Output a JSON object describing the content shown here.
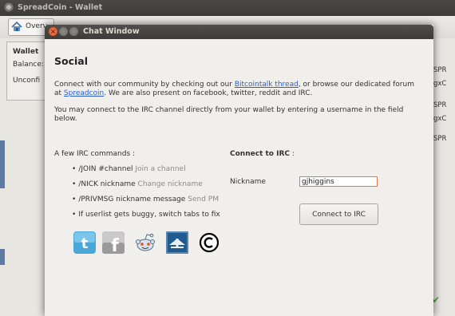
{
  "app": {
    "title": "SpreadCoin - Wallet",
    "toolbar": {
      "overview_label": "Overv"
    },
    "wallet_panel": {
      "heading": "Wallet",
      "balance_label": "Balance:",
      "unconfirmed_label": "Unconfi"
    },
    "right_fragments": [
      "SPR",
      "gxC",
      "SPR",
      "gxC",
      "SPR"
    ]
  },
  "dialog": {
    "title": "Chat Window",
    "heading": "Social",
    "intro": {
      "part1": "Connect with our community by checking out our ",
      "link1": "Bitcointalk thread",
      "part2": ", or browse our dedicated forum at ",
      "link2": "Spreadcoin",
      "part3": ". We are also present on facebook, twitter, reddit and IRC."
    },
    "irc_intro": "You may connect to the IRC channel directly from your wallet by entering a username in the field below.",
    "commands_title": "A few IRC commands :",
    "commands": [
      {
        "cmd": "/JOIN #channel",
        "hint": "Join a channel"
      },
      {
        "cmd": "/NICK nickname",
        "hint": "Change nickname"
      },
      {
        "cmd": "/PRIVMSG nickname message",
        "hint": "Send PM"
      },
      {
        "cmd": "If userlist gets buggy, switch tabs to fix",
        "hint": ""
      }
    ],
    "connect": {
      "title": "Connect to IRC",
      "title_suffix": " :",
      "nickname_label": "Nickname",
      "nickname_value": "gjhiggins",
      "button_label": "Connect to IRC"
    },
    "social_icons": [
      "twitter-icon",
      "facebook-icon",
      "reddit-icon",
      "bitcointalk-icon",
      "copyright-icon"
    ]
  },
  "colors": {
    "link": "#2b5ec9",
    "input_focus_border": "#e07a4a",
    "close_button": "#d9481e"
  }
}
